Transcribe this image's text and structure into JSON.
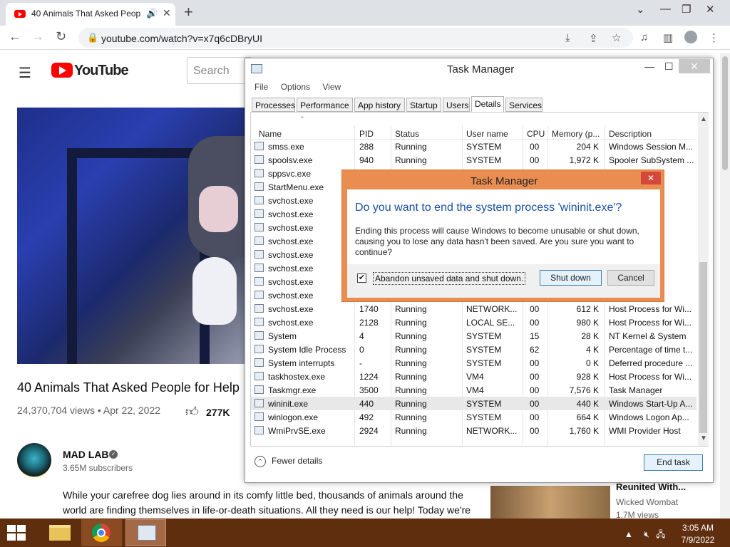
{
  "browser": {
    "tab_title": "40 Animals That Asked Peop",
    "url": "youtube.com/watch?v=x7q6cDBryUI"
  },
  "youtube": {
    "logo_text": "YouTube",
    "search_placeholder": "Search",
    "video_title": "40 Animals That Asked People for Help",
    "views_date": "24,370,704 views • Apr 22, 2022",
    "likes": "277K",
    "channel_name": "MAD LAB",
    "subscribers": "3.65M subscribers",
    "description_line1": "While your carefree dog lies around in its comfy little bed, thousands of animals around the",
    "description_line2": "world are finding themselves in life-or-death situations. All they need is our help! Today we're",
    "suggested": {
      "title": "Reunited With...",
      "channel": "Wicked Wombat",
      "views": "1.7M views"
    }
  },
  "task_manager": {
    "title": "Task Manager",
    "menu": [
      "File",
      "Options",
      "View"
    ],
    "tabs": [
      "Processes",
      "Performance",
      "App history",
      "Startup",
      "Users",
      "Details",
      "Services"
    ],
    "active_tab": "Details",
    "columns": [
      "Name",
      "PID",
      "Status",
      "User name",
      "CPU",
      "Memory (p...",
      "Description"
    ],
    "rows": [
      {
        "name": "smss.exe",
        "pid": "288",
        "status": "Running",
        "user": "SYSTEM",
        "cpu": "00",
        "mem": "204 K",
        "desc": "Windows Session M..."
      },
      {
        "name": "spoolsv.exe",
        "pid": "940",
        "status": "Running",
        "user": "SYSTEM",
        "cpu": "00",
        "mem": "1,972 K",
        "desc": "Spooler SubSystem ..."
      },
      {
        "name": "sppsvc.exe",
        "pid": "",
        "status": "",
        "user": "",
        "cpu": "",
        "mem": "",
        "desc": "are ..."
      },
      {
        "name": "StartMenu.exe",
        "pid": "",
        "status": "",
        "user": "",
        "cpu": "",
        "mem": "",
        "desc": "u"
      },
      {
        "name": "svchost.exe",
        "pid": "",
        "status": "",
        "user": "",
        "cpu": "",
        "mem": "",
        "desc": "r Wi..."
      },
      {
        "name": "svchost.exe",
        "pid": "",
        "status": "",
        "user": "",
        "cpu": "",
        "mem": "",
        "desc": "Wi..."
      },
      {
        "name": "svchost.exe",
        "pid": "",
        "status": "",
        "user": "",
        "cpu": "",
        "mem": "",
        "desc": "Wi..."
      },
      {
        "name": "svchost.exe",
        "pid": "",
        "status": "",
        "user": "",
        "cpu": "",
        "mem": "",
        "desc": "Wi..."
      },
      {
        "name": "svchost.exe",
        "pid": "",
        "status": "",
        "user": "",
        "cpu": "",
        "mem": "",
        "desc": "Wi..."
      },
      {
        "name": "svchost.exe",
        "pid": "",
        "status": "",
        "user": "",
        "cpu": "",
        "mem": "",
        "desc": "Wi..."
      },
      {
        "name": "svchost.exe",
        "pid": "",
        "status": "",
        "user": "",
        "cpu": "",
        "mem": "",
        "desc": "Wi..."
      },
      {
        "name": "svchost.exe",
        "pid": "",
        "status": "",
        "user": "",
        "cpu": "",
        "mem": "",
        "desc": "Wi..."
      },
      {
        "name": "svchost.exe",
        "pid": "1740",
        "status": "Running",
        "user": "NETWORK...",
        "cpu": "00",
        "mem": "612 K",
        "desc": "Host Process for Wi..."
      },
      {
        "name": "svchost.exe",
        "pid": "2128",
        "status": "Running",
        "user": "LOCAL SE...",
        "cpu": "00",
        "mem": "980 K",
        "desc": "Host Process for Wi..."
      },
      {
        "name": "System",
        "pid": "4",
        "status": "Running",
        "user": "SYSTEM",
        "cpu": "15",
        "mem": "28 K",
        "desc": "NT Kernel & System"
      },
      {
        "name": "System Idle Process",
        "pid": "0",
        "status": "Running",
        "user": "SYSTEM",
        "cpu": "62",
        "mem": "4 K",
        "desc": "Percentage of time t..."
      },
      {
        "name": "System interrupts",
        "pid": "-",
        "status": "Running",
        "user": "SYSTEM",
        "cpu": "00",
        "mem": "0 K",
        "desc": "Deferred procedure ..."
      },
      {
        "name": "taskhostex.exe",
        "pid": "1224",
        "status": "Running",
        "user": "VM4",
        "cpu": "00",
        "mem": "928 K",
        "desc": "Host Process for Wi..."
      },
      {
        "name": "Taskmgr.exe",
        "pid": "3500",
        "status": "Running",
        "user": "VM4",
        "cpu": "00",
        "mem": "7,576 K",
        "desc": "Task Manager"
      },
      {
        "name": "wininit.exe",
        "pid": "440",
        "status": "Running",
        "user": "SYSTEM",
        "cpu": "00",
        "mem": "440 K",
        "desc": "Windows Start-Up A..."
      },
      {
        "name": "winlogon.exe",
        "pid": "492",
        "status": "Running",
        "user": "SYSTEM",
        "cpu": "00",
        "mem": "664 K",
        "desc": "Windows Logon Ap..."
      },
      {
        "name": "WmiPrvSE.exe",
        "pid": "2924",
        "status": "Running",
        "user": "NETWORK...",
        "cpu": "00",
        "mem": "1,760 K",
        "desc": "WMI Provider Host"
      }
    ],
    "selected_row": "wininit.exe",
    "fewer_details": "Fewer details",
    "end_task": "End task"
  },
  "dialog": {
    "title": "Task Manager",
    "question": "Do you want to end the system process 'wininit.exe'?",
    "message": "Ending this process will cause Windows to become unusable or shut down, causing you to lose any data hasn't been saved. Are you sure you want to continue?",
    "checkbox_label": "Abandon unsaved data and shut down.",
    "checkbox_checked": true,
    "shut_down": "Shut down",
    "cancel": "Cancel",
    "accent_color": "#ea8d50"
  },
  "taskbar": {
    "time": "3:05 AM",
    "date": "7/9/2022"
  }
}
